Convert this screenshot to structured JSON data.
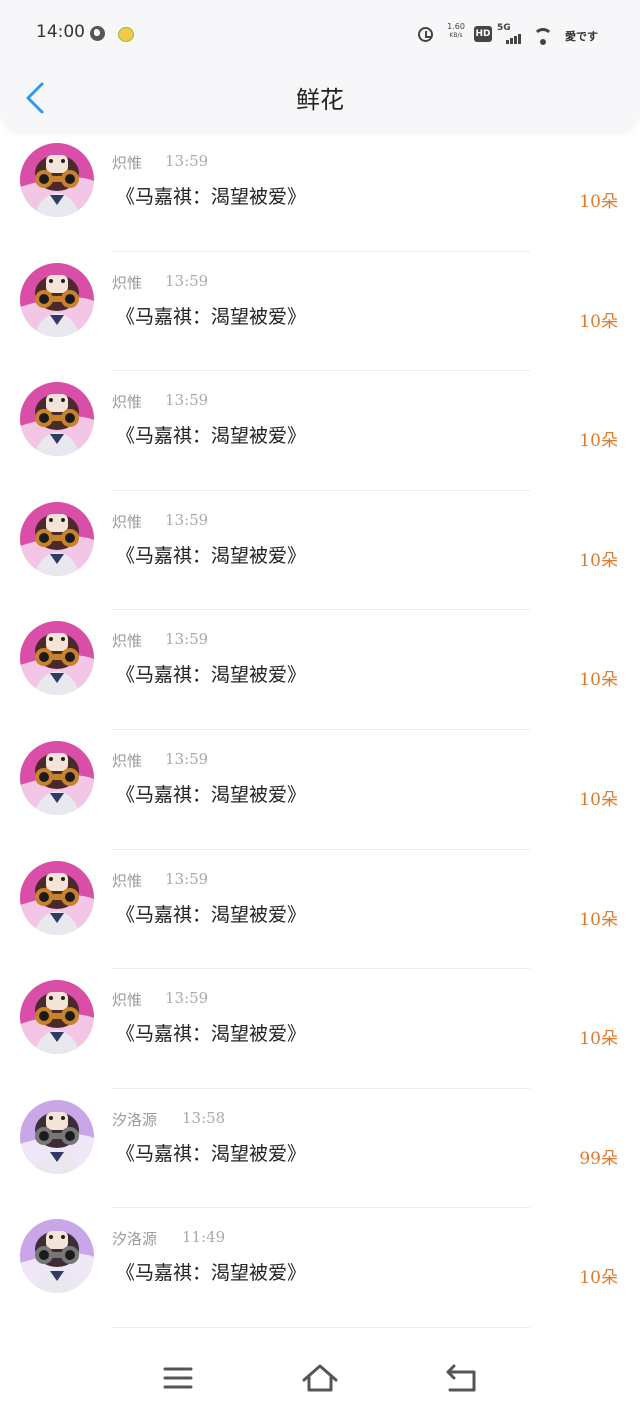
{
  "status_bar": {
    "time": "14:00",
    "net_speed_value": "1.60",
    "net_speed_unit": "KB/s",
    "hd_badge": "HD",
    "network": "5G",
    "carrier": "愛です",
    "icon_color": "#444444"
  },
  "header": {
    "title": "鲜花",
    "back_icon": "chevron-left-icon",
    "accent_color": "#2b9af3"
  },
  "list": {
    "amount_color": "#e07a2c",
    "items": [
      {
        "name": "炽惟",
        "time": "13:59",
        "title": "《马嘉祺：渴望被爱》",
        "amount": "10朵",
        "avatar": "avatar-pink-binoculars"
      },
      {
        "name": "炽惟",
        "time": "13:59",
        "title": "《马嘉祺：渴望被爱》",
        "amount": "10朵",
        "avatar": "avatar-pink-binoculars"
      },
      {
        "name": "炽惟",
        "time": "13:59",
        "title": "《马嘉祺：渴望被爱》",
        "amount": "10朵",
        "avatar": "avatar-pink-binoculars"
      },
      {
        "name": "炽惟",
        "time": "13:59",
        "title": "《马嘉祺：渴望被爱》",
        "amount": "10朵",
        "avatar": "avatar-pink-binoculars"
      },
      {
        "name": "炽惟",
        "time": "13:59",
        "title": "《马嘉祺：渴望被爱》",
        "amount": "10朵",
        "avatar": "avatar-pink-binoculars"
      },
      {
        "name": "炽惟",
        "time": "13:59",
        "title": "《马嘉祺：渴望被爱》",
        "amount": "10朵",
        "avatar": "avatar-pink-binoculars"
      },
      {
        "name": "炽惟",
        "time": "13:59",
        "title": "《马嘉祺：渴望被爱》",
        "amount": "10朵",
        "avatar": "avatar-pink-binoculars"
      },
      {
        "name": "炽惟",
        "time": "13:59",
        "title": "《马嘉祺：渴望被爱》",
        "amount": "10朵",
        "avatar": "avatar-pink-binoculars"
      },
      {
        "name": "汐洛源",
        "time": "13:58",
        "title": "《马嘉祺：渴望被爱》",
        "amount": "99朵",
        "avatar": "avatar-purple-binoculars"
      },
      {
        "name": "汐洛源",
        "time": "11:49",
        "title": "《马嘉祺：渴望被爱》",
        "amount": "10朵",
        "avatar": "avatar-purple-binoculars"
      }
    ]
  },
  "nav_bar": {
    "buttons": [
      "menu-icon",
      "home-icon",
      "back-icon"
    ]
  }
}
